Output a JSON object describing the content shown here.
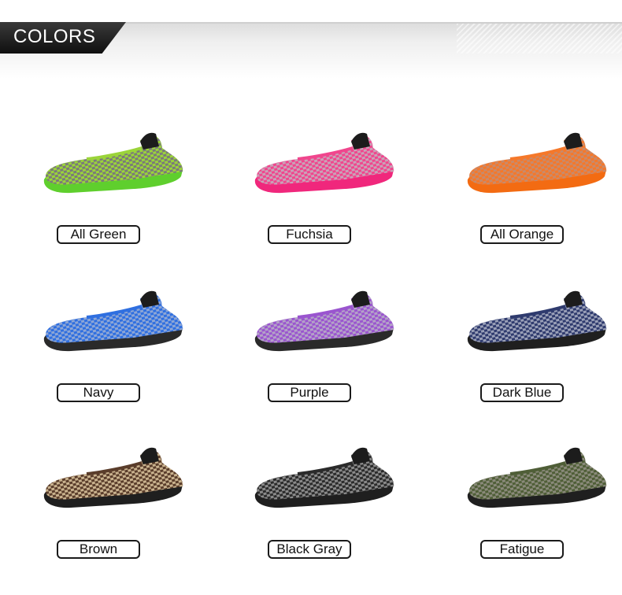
{
  "header": {
    "title": "COLORS"
  },
  "colors": [
    {
      "label": "All Green",
      "upper": "#9bd43a",
      "accent": "#7a7a7a",
      "sole": "#5fcf2d"
    },
    {
      "label": "Fuchsia",
      "upper": "#f0468d",
      "accent": "#c9a3b8",
      "sole": "#f0277c"
    },
    {
      "label": "All Orange",
      "upper": "#f5782a",
      "accent": "#c98a6a",
      "sole": "#f36b12"
    },
    {
      "label": "Navy",
      "upper": "#2f6fe0",
      "accent": "#8da6d6",
      "sole": "#2a2a2a"
    },
    {
      "label": "Purple",
      "upper": "#9a55cf",
      "accent": "#b4a2c8",
      "sole": "#2a2a2a"
    },
    {
      "label": "Dark Blue",
      "upper": "#2f3b6e",
      "accent": "#9aa0b8",
      "sole": "#1f1f1f"
    },
    {
      "label": "Brown",
      "upper": "#5a3d2b",
      "accent": "#c9b28e",
      "sole": "#1f1f1f"
    },
    {
      "label": "Black Gray",
      "upper": "#2b2b2b",
      "accent": "#8a8a8a",
      "sole": "#1f1f1f"
    },
    {
      "label": "Fatigue",
      "upper": "#4f5e37",
      "accent": "#8a8a7a",
      "sole": "#1f1f1f"
    }
  ]
}
